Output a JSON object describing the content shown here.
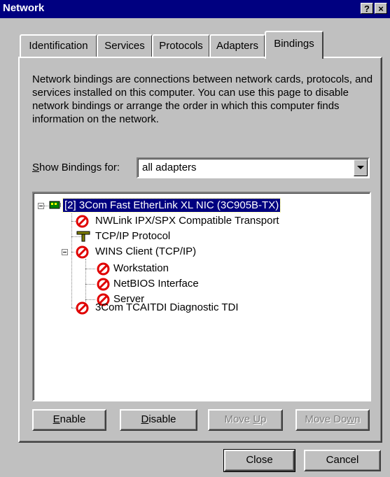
{
  "window": {
    "title": "Network",
    "help_label": "?",
    "close_label": "×"
  },
  "tabs": [
    {
      "label": "Identification",
      "active": false
    },
    {
      "label": "Services",
      "active": false
    },
    {
      "label": "Protocols",
      "active": false
    },
    {
      "label": "Adapters",
      "active": false
    },
    {
      "label": "Bindings",
      "active": true
    }
  ],
  "bindings": {
    "description": "Network bindings are connections between network cards, protocols, and services installed on this computer.  You can use this page to disable network bindings or arrange the order in which this computer finds information on the network.",
    "show_label_prefix": "S",
    "show_label_rest": "how Bindings for:",
    "select_value": "all adapters",
    "tree": [
      {
        "label": "[2] 3Com Fast EtherLink XL NIC (3C905B-TX)",
        "icon": "network-card-icon",
        "selected": true
      },
      {
        "label": "NWLink IPX/SPX Compatible Transport",
        "icon": "disabled-icon"
      },
      {
        "label": "TCP/IP Protocol",
        "icon": "protocol-icon"
      },
      {
        "label": "WINS Client (TCP/IP)",
        "icon": "disabled-icon"
      },
      {
        "label": "Workstation",
        "icon": "disabled-icon"
      },
      {
        "label": "NetBIOS Interface",
        "icon": "disabled-icon"
      },
      {
        "label": "Server",
        "icon": "disabled-icon"
      },
      {
        "label": "3Com TCAITDI Diagnostic TDI",
        "icon": "disabled-icon"
      }
    ],
    "buttons": {
      "enable_u": "E",
      "enable_rest": "nable",
      "disable_u": "D",
      "disable_rest": "isable",
      "moveup_pre": "Move ",
      "moveup_u": "U",
      "moveup_rest": "p",
      "movedown_pre": "Move Do",
      "movedown_u": "w",
      "movedown_rest": "n"
    }
  },
  "footer": {
    "close_label": "Close",
    "cancel_label": "Cancel"
  },
  "colors": {
    "titlebar": "#000080",
    "face": "#c0c0c0",
    "disabled_red": "#e00000"
  }
}
